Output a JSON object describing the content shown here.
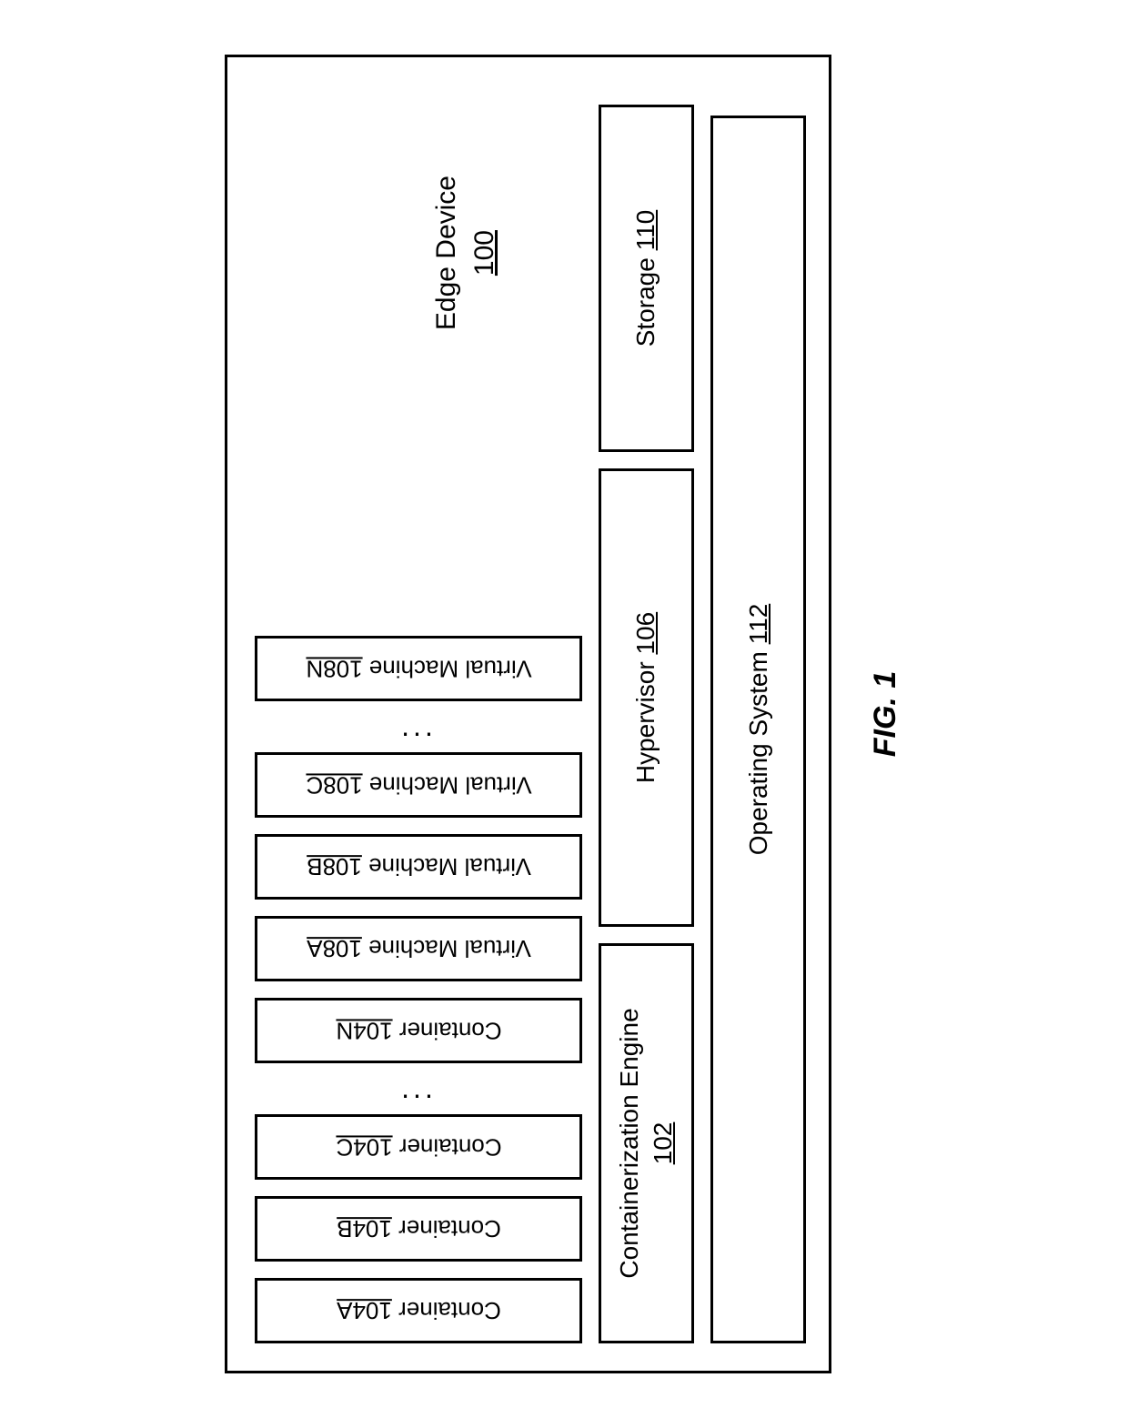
{
  "figure_label": "FIG. 1",
  "edge_device": {
    "label": "Edge Device",
    "ref": "100"
  },
  "containers": [
    {
      "label": "Container",
      "ref": "104A"
    },
    {
      "label": "Container",
      "ref": "104B"
    },
    {
      "label": "Container",
      "ref": "104C"
    },
    {
      "label": "Container",
      "ref": "104N"
    }
  ],
  "vms": [
    {
      "label": "Virtual Machine",
      "ref": "108A"
    },
    {
      "label": "Virtual Machine",
      "ref": "108B"
    },
    {
      "label": "Virtual Machine",
      "ref": "108C"
    },
    {
      "label": "Virtual Machine",
      "ref": "108N"
    }
  ],
  "containerization_engine": {
    "label": "Containerization Engine",
    "ref": "102"
  },
  "hypervisor": {
    "label": "Hypervisor",
    "ref": "106"
  },
  "storage": {
    "label": "Storage",
    "ref": "110"
  },
  "os": {
    "label": "Operating System",
    "ref": "112"
  },
  "ellipsis": "..."
}
